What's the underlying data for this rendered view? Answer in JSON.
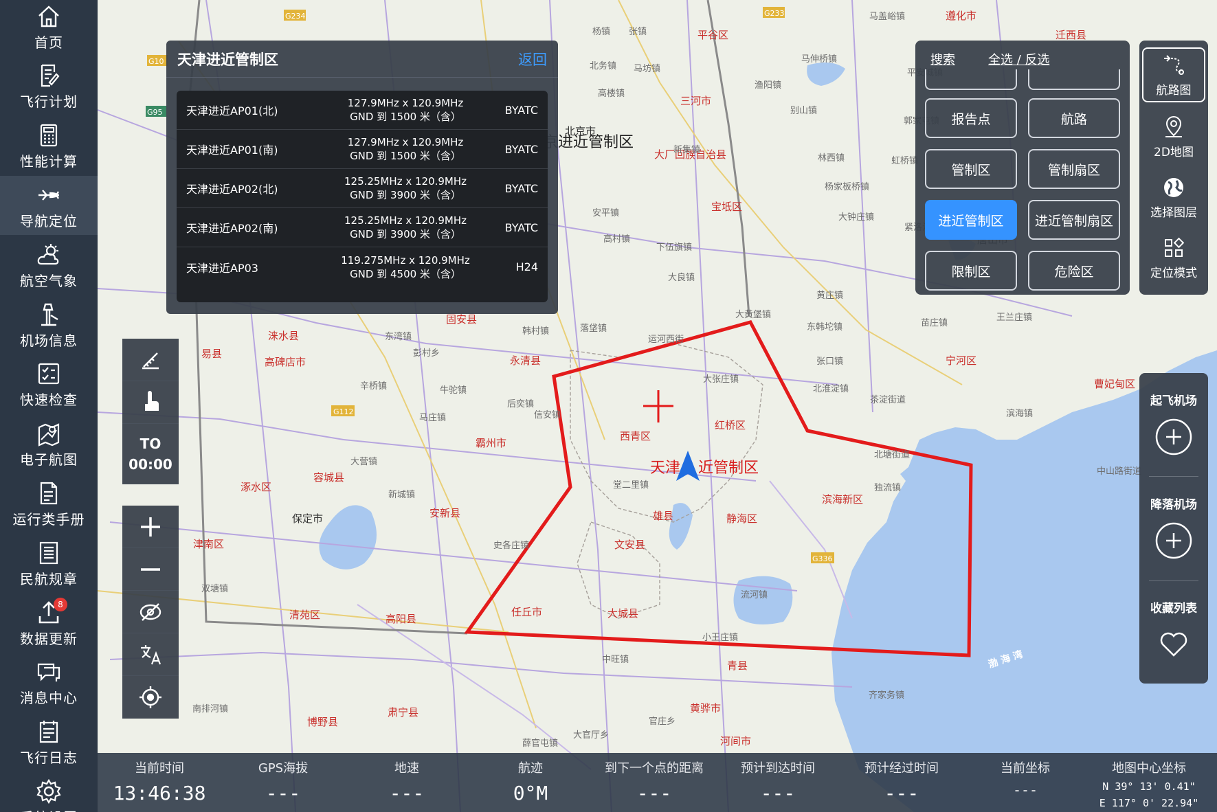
{
  "sidebar": {
    "items": [
      {
        "label": "首页",
        "icon": "home-icon"
      },
      {
        "label": "飞行计划",
        "icon": "flight-plan-icon"
      },
      {
        "label": "性能计算",
        "icon": "calculator-icon"
      },
      {
        "label": "导航定位",
        "icon": "airplane-icon",
        "active": true
      },
      {
        "label": "航空气象",
        "icon": "weather-icon"
      },
      {
        "label": "机场信息",
        "icon": "airport-tower-icon"
      },
      {
        "label": "快速检查",
        "icon": "checklist-icon"
      },
      {
        "label": "电子航图",
        "icon": "chart-map-icon"
      },
      {
        "label": "运行类手册",
        "icon": "manual-icon"
      },
      {
        "label": "民航规章",
        "icon": "regulation-icon"
      },
      {
        "label": "数据更新",
        "icon": "upload-icon",
        "badge": "8"
      },
      {
        "label": "消息中心",
        "icon": "message-icon"
      },
      {
        "label": "飞行日志",
        "icon": "logbook-icon"
      },
      {
        "label": "系统设置",
        "icon": "gear-icon"
      }
    ]
  },
  "airspace_panel": {
    "title": "天津进近管制区",
    "back_label": "返回",
    "rows": [
      {
        "name": "天津进近AP01(北)",
        "freq": "127.9MHz x 120.9MHz",
        "range": "GND 到 1500 米（含）",
        "unit": "BYATC"
      },
      {
        "name": "天津进近AP01(南)",
        "freq": "127.9MHz x 120.9MHz",
        "range": "GND 到 1500 米（含）",
        "unit": "BYATC"
      },
      {
        "name": "天津进近AP02(北)",
        "freq": "125.25MHz x 120.9MHz",
        "range": "GND 到 3900 米（含）",
        "unit": "BYATC"
      },
      {
        "name": "天津进近AP02(南)",
        "freq": "125.25MHz x 120.9MHz",
        "range": "GND 到 3900 米（含）",
        "unit": "BYATC"
      },
      {
        "name": "天津进近AP03",
        "freq": "119.275MHz x 120.9MHz",
        "range": "GND 到 4500 米（含）",
        "unit": "H24"
      }
    ]
  },
  "layer_panel": {
    "search_label": "搜索",
    "select_label": "全选 / 反选",
    "buttons": [
      {
        "label": "报告点",
        "on": false
      },
      {
        "label": "航路",
        "on": false
      },
      {
        "label": "管制区",
        "on": false
      },
      {
        "label": "管制扇区",
        "on": false
      },
      {
        "label": "进近管制区",
        "on": true
      },
      {
        "label": "进近管制扇区",
        "on": false
      },
      {
        "label": "限制区",
        "on": false
      },
      {
        "label": "危险区",
        "on": false
      }
    ]
  },
  "right_tools": {
    "route_map": "航路图",
    "map_2d": "2D地图",
    "layer_select": "选择图层",
    "locate_mode": "定位模式"
  },
  "airport_panel": {
    "takeoff": "起飞机场",
    "landing": "降落机场",
    "favorites": "收藏列表"
  },
  "map_tools": {
    "to_label": "TO",
    "to_time": "00:00"
  },
  "status_bar": {
    "current_time_label": "当前时间",
    "current_time": "13:46:38",
    "gps_alt_label": "GPS海拔",
    "gps_alt": "---",
    "ground_speed_label": "地速",
    "ground_speed": "---",
    "track_label": "航迹",
    "track": "0°M",
    "dist_next_label": "到下一个点的距离",
    "dist_next": "---",
    "eta_label": "预计到达时间",
    "eta": "---",
    "ete_label": "预计经过时间",
    "ete": "---",
    "current_coord_label": "当前坐标",
    "current_coord": "---",
    "map_center_label": "地图中心坐标",
    "map_center_lat": "N 39° 13' 0.41\"",
    "map_center_lon": "E 117° 0' 22.94\""
  },
  "map": {
    "zone_label_a": "天津",
    "zone_label_b": "近管制区",
    "beijing_zone_label": "京进近管制区",
    "bay_label": "渤 海 湾",
    "places": [
      {
        "t": "马盖峪镇"
      },
      {
        "t": "遵化市"
      },
      {
        "t": "迁西县"
      },
      {
        "t": "杨镇"
      },
      {
        "t": "张镇"
      },
      {
        "t": "平谷区"
      },
      {
        "t": "北务镇"
      },
      {
        "t": "马坊镇"
      },
      {
        "t": "马伸桥镇"
      },
      {
        "t": "平安城镇"
      },
      {
        "t": "高楼镇"
      },
      {
        "t": "三河市"
      },
      {
        "t": "渔阳镇"
      },
      {
        "t": "别山镇"
      },
      {
        "t": "郭家屯镇"
      },
      {
        "t": "北京市"
      },
      {
        "t": "大厂回族自治县"
      },
      {
        "t": "新集镇"
      },
      {
        "t": "林西镇"
      },
      {
        "t": "虹桥镇"
      },
      {
        "t": "宝坻区"
      },
      {
        "t": "杨家板桥镇"
      },
      {
        "t": "安平镇"
      },
      {
        "t": "大钟庄镇"
      },
      {
        "t": "紧洛沽镇"
      },
      {
        "t": "高村镇"
      },
      {
        "t": "下伍旗镇"
      },
      {
        "t": "唐山市"
      },
      {
        "t": "大良镇"
      },
      {
        "t": "丰台镇"
      },
      {
        "t": "黄庄镇"
      },
      {
        "t": "大黄堡镇"
      },
      {
        "t": "东韩坨镇"
      },
      {
        "t": "苗庄镇"
      },
      {
        "t": "王兰庄镇"
      },
      {
        "t": "固安县"
      },
      {
        "t": "涞水县"
      },
      {
        "t": "东湾镇"
      },
      {
        "t": "彭村乡"
      },
      {
        "t": "永清县"
      },
      {
        "t": "韩村镇"
      },
      {
        "t": "落垡镇"
      },
      {
        "t": "运河西街"
      },
      {
        "t": "张口镇"
      },
      {
        "t": "宁河区"
      },
      {
        "t": "易县"
      },
      {
        "t": "高碑店市"
      },
      {
        "t": "辛桥镇"
      },
      {
        "t": "牛驼镇"
      },
      {
        "t": "后奕镇"
      },
      {
        "t": "大张庄镇"
      },
      {
        "t": "北淮淀镇"
      },
      {
        "t": "茶淀街道"
      },
      {
        "t": "曹妃甸区"
      },
      {
        "t": "滨海镇"
      },
      {
        "t": "霸州市"
      },
      {
        "t": "马庄镇"
      },
      {
        "t": "信安镇"
      },
      {
        "t": "西青区"
      },
      {
        "t": "红桥区"
      },
      {
        "t": "北塘街道"
      },
      {
        "t": "中山路街道"
      },
      {
        "t": "涿水区"
      },
      {
        "t": "容城县"
      },
      {
        "t": "大营镇"
      },
      {
        "t": "堂二里镇"
      },
      {
        "t": "独流镇"
      },
      {
        "t": "滨海新区"
      },
      {
        "t": "新城镇"
      },
      {
        "t": "雄县"
      },
      {
        "t": "静海区"
      },
      {
        "t": "津南区"
      },
      {
        "t": "保定市"
      },
      {
        "t": "安新县"
      },
      {
        "t": "史各庄镇"
      },
      {
        "t": "文安县"
      },
      {
        "t": "双塘镇"
      },
      {
        "t": "清苑区"
      },
      {
        "t": "高阳县"
      },
      {
        "t": "任丘市"
      },
      {
        "t": "大城县"
      },
      {
        "t": "流河镇"
      },
      {
        "t": "小王庄镇"
      },
      {
        "t": "中旺镇"
      },
      {
        "t": "青县"
      },
      {
        "t": "齐家务镇"
      },
      {
        "t": "南排河镇"
      },
      {
        "t": "博野县"
      },
      {
        "t": "肃宁县"
      },
      {
        "t": "河间市"
      },
      {
        "t": "黄骅市"
      },
      {
        "t": "官庄乡"
      },
      {
        "t": "薛官屯镇"
      },
      {
        "t": "大官厅乡"
      },
      {
        "t": "新兴镇"
      }
    ]
  }
}
